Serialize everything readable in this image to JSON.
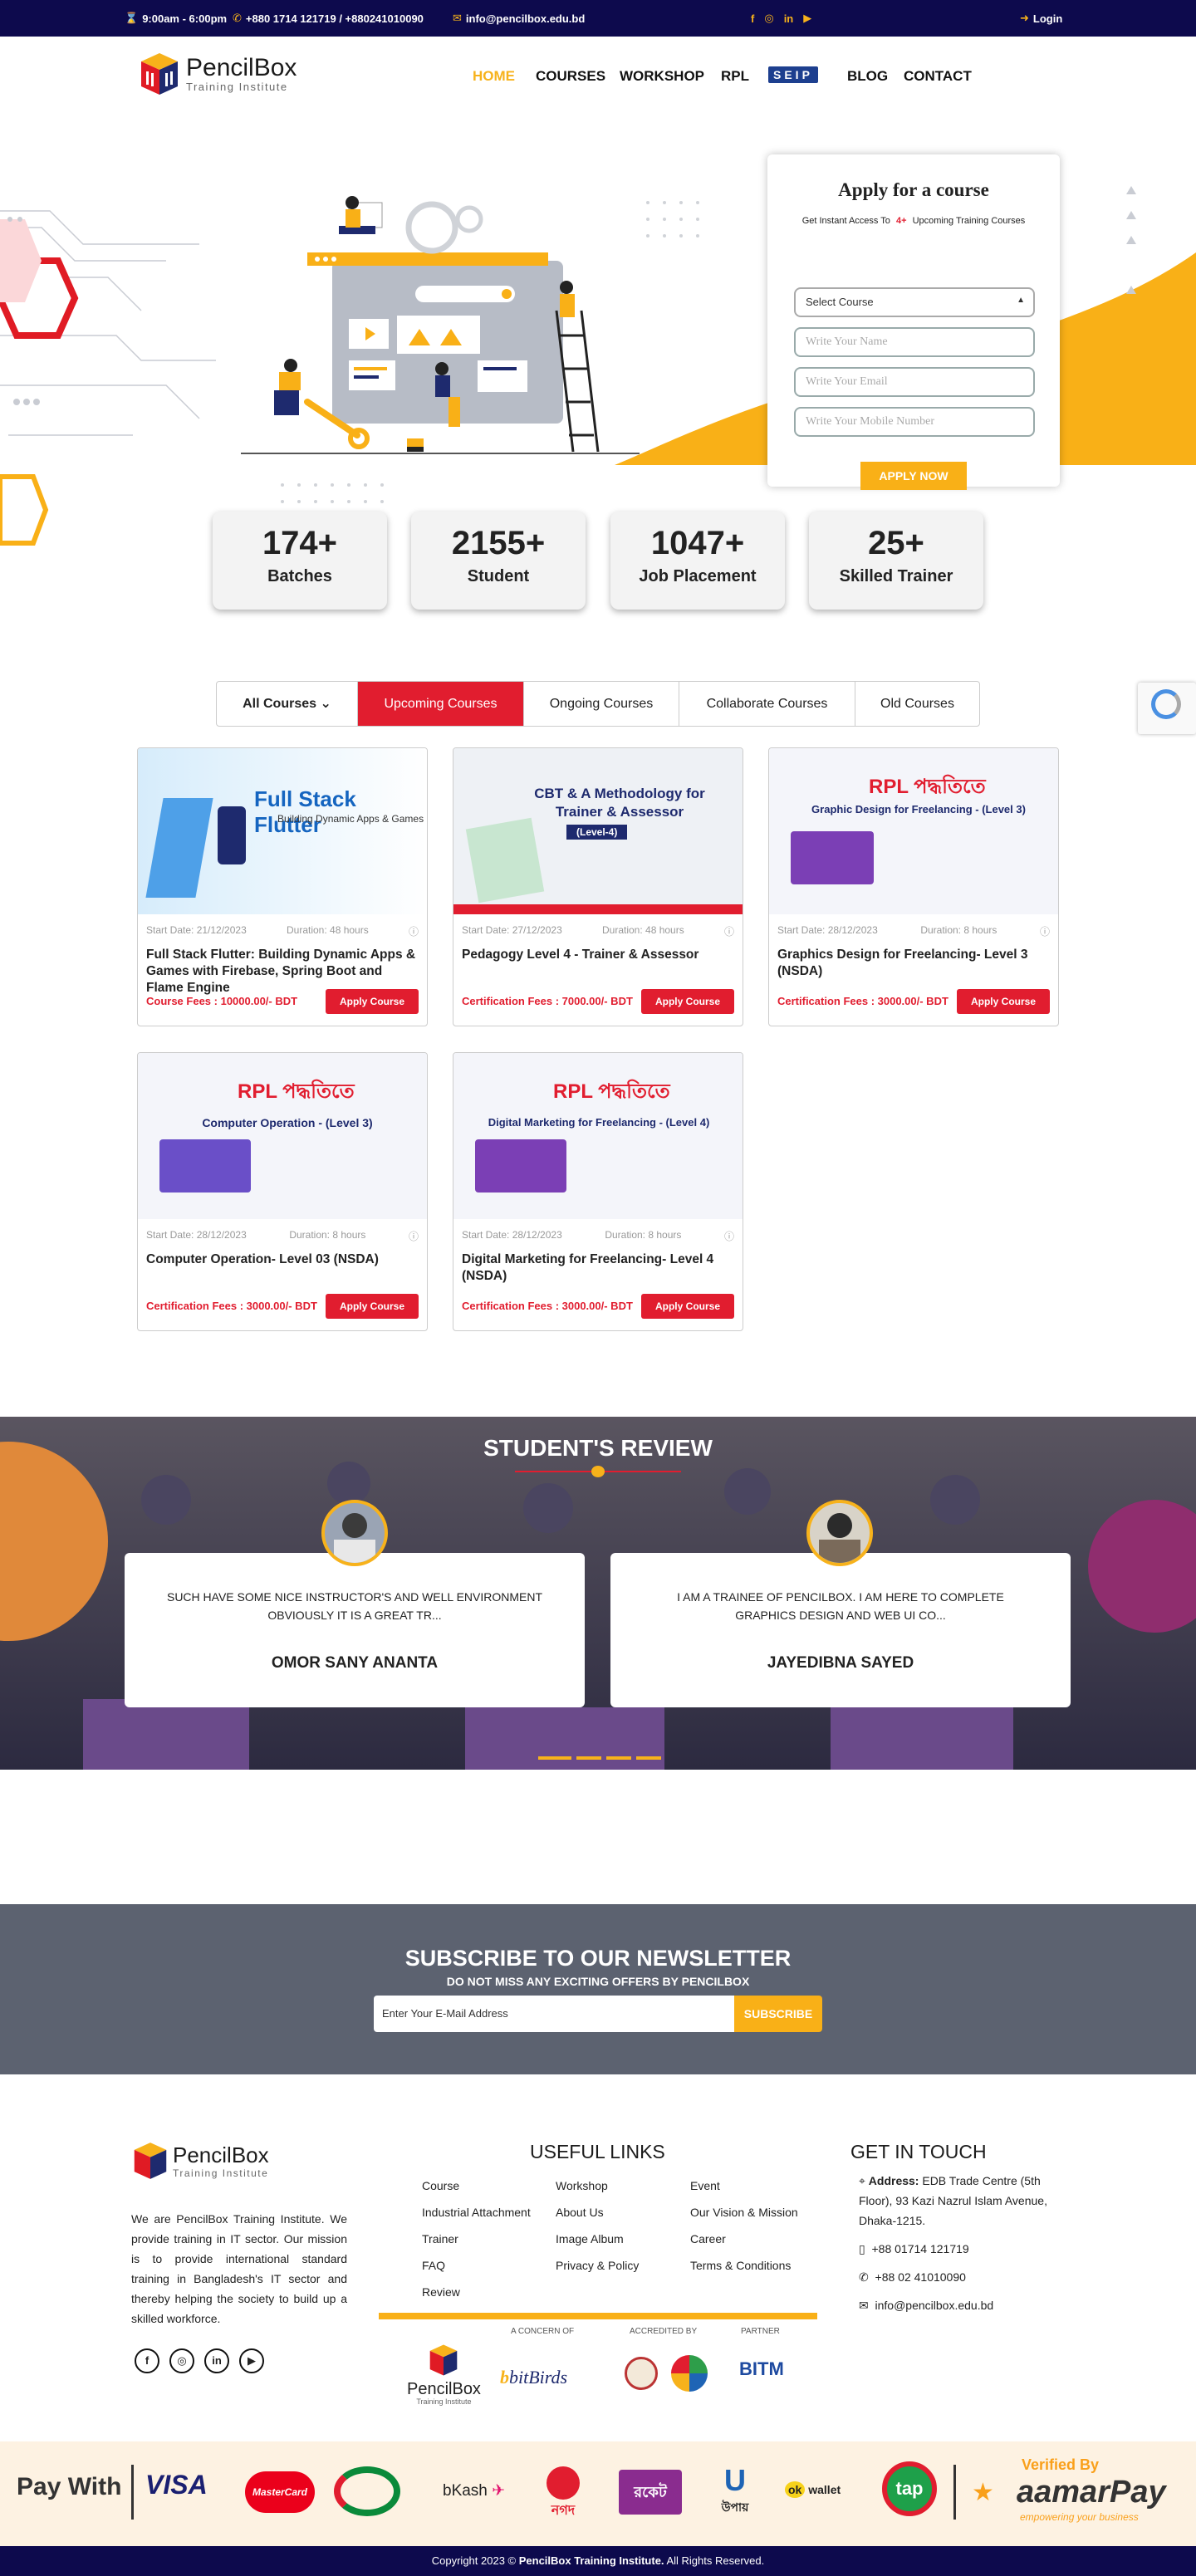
{
  "topbar": {
    "hours": "9:00am - 6:00pm",
    "phones": "+880 1714 121719  / +880241010090",
    "email": "info@pencilbox.edu.bd",
    "login": "Login"
  },
  "brand": {
    "name": "PencilBox",
    "tagline": "Training Institute"
  },
  "nav": {
    "home": "HOME",
    "courses": "COURSES",
    "workshop": "WORKSHOP",
    "rpl": "RPL",
    "seip": "SEIP",
    "blog": "BLOG",
    "contact": "CONTACT"
  },
  "apply_form": {
    "title": "Apply for a course",
    "sub_prefix": "Get Instant Access To",
    "count": "4+",
    "sub_suffix": "Upcoming Training Courses",
    "select": "Select Course",
    "name_ph": "Write Your Name",
    "email_ph": "Write Your Email",
    "mobile_ph": "Write Your Mobile Number",
    "button": "APPLY NOW"
  },
  "stats": [
    {
      "value": "174+",
      "label": "Batches"
    },
    {
      "value": "2155+",
      "label": "Student"
    },
    {
      "value": "1047+",
      "label": "Job Placement"
    },
    {
      "value": "25+",
      "label": "Skilled Trainer"
    }
  ],
  "tabs": [
    "All Courses",
    "Upcoming Courses",
    "Ongoing Courses",
    "Collaborate Courses",
    "Old Courses"
  ],
  "courses": [
    {
      "banner": "Full Stack Flutter",
      "banner_sub": "Building Dynamic Apps & Games",
      "start": "Start Date: 21/12/2023",
      "duration": "Duration: 48 hours",
      "title": "Full Stack Flutter: Building Dynamic Apps & Games with Firebase, Spring Boot and Flame Engine",
      "fee": "Course Fees : 10000.00/- BDT",
      "button": "Apply Course"
    },
    {
      "banner": "CBT & A Methodology for Trainer & Assessor",
      "banner_sub": "(Level-4)",
      "start": "Start Date: 27/12/2023",
      "duration": "Duration: 48 hours",
      "title": "Pedagogy Level 4 - Trainer & Assessor",
      "fee": "Certification Fees : 7000.00/- BDT",
      "button": "Apply Course"
    },
    {
      "banner": "RPL পদ্ধতিতে",
      "banner_sub": "Graphic Design for Freelancing - (Level 3)",
      "start": "Start Date: 28/12/2023",
      "duration": "Duration: 8 hours",
      "title": "Graphics Design for Freelancing- Level 3 (NSDA)",
      "fee": "Certification Fees : 3000.00/- BDT",
      "button": "Apply Course"
    },
    {
      "banner": "RPL পদ্ধতিতে",
      "banner_sub": "Computer Operation - (Level 3)",
      "start": "Start Date: 28/12/2023",
      "duration": "Duration: 8 hours",
      "title": "Computer Operation- Level 03 (NSDA)",
      "fee": "Certification Fees : 3000.00/- BDT",
      "button": "Apply Course"
    },
    {
      "banner": "RPL পদ্ধতিতে",
      "banner_sub": "Digital Marketing for Freelancing - (Level 4)",
      "start": "Start Date: 28/12/2023",
      "duration": "Duration: 8 hours",
      "title": "Digital Marketing for Freelancing- Level 4 (NSDA)",
      "fee": "Certification Fees : 3000.00/- BDT",
      "button": "Apply Course"
    }
  ],
  "reviews": {
    "title": "STUDENT'S REVIEW",
    "items": [
      {
        "quote": "SUCH HAVE SOME NICE INSTRUCTOR'S AND WELL ENVIRONMENT OBVIOUSLY IT IS A GREAT TR...",
        "name": "OMOR SANY ANANTA"
      },
      {
        "quote": "I AM A TRAINEE OF PENCILBOX. I AM HERE TO COMPLETE GRAPHICS DESIGN AND WEB UI CO...",
        "name": "JAYEDIBNA SAYED"
      }
    ]
  },
  "newsletter": {
    "title": "SUBSCRIBE TO OUR NEWSLETTER",
    "subtitle": "DO NOT MISS ANY EXCITING OFFERS BY PENCILBOX",
    "placeholder": "Enter Your E-Mail Address",
    "button": "SUBSCRIBE"
  },
  "footer": {
    "about": "We are PencilBox Training Institute. We provide training in IT sector. Our mission is to provide international standard training in Bangladesh's IT sector and thereby helping the society to build up a skilled workforce.",
    "links_title": "USEFUL LINKS",
    "links_col1": [
      "Course",
      "Industrial Attachment",
      "Trainer",
      "FAQ",
      "Review"
    ],
    "links_col2": [
      "Workshop",
      "About Us",
      "Image Album",
      "Privacy & Policy"
    ],
    "links_col3": [
      "Event",
      "Our Vision & Mission",
      "Career",
      "Terms & Conditions"
    ],
    "contact_title": "GET IN TOUCH",
    "address_label": "Address:",
    "address": "EDB Trade Centre (5th Floor), 93 Kazi Nazrul Islam Avenue, Dhaka-1215.",
    "mobile": "+88 01714 121719",
    "phone": "+88 02 41010090",
    "email": "info@pencilbox.edu.bd",
    "concern_label": "A CONCERN OF",
    "accredited_label": "ACCREDITED BY",
    "partner_label": "PARTNER",
    "bitbirds": "bitBirds"
  },
  "payments": {
    "label": "Pay With",
    "methods": [
      "VISA",
      "MasterCard",
      "bKash",
      "নগদ",
      "রকেট",
      "উপায়",
      "wallet",
      "tap"
    ],
    "verified": "Verified By",
    "aamarpay": "aamarPay",
    "aamar_tag": "empowering your business"
  },
  "copyright": {
    "prefix": "Copyright 2023 ©",
    "org": "PencilBox Training Institute.",
    "suffix": "All Rights Reserved."
  }
}
